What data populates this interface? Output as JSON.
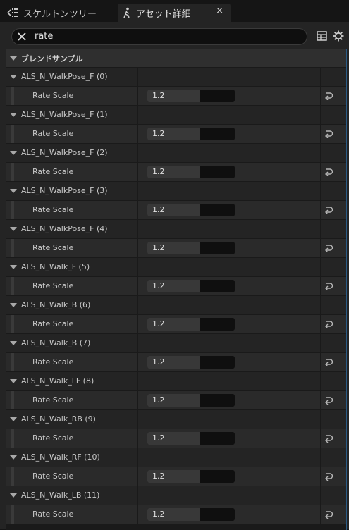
{
  "tabs": {
    "skeleton_tree": "スケルトンツリー",
    "asset_details": "アセット詳細",
    "close": "×"
  },
  "search": {
    "value": "rate",
    "placeholder": ""
  },
  "category": {
    "label": "ブレンドサンプル"
  },
  "samples": [
    {
      "name": "ALS_N_WalkPose_F (0)",
      "property": "Rate Scale",
      "value": "1.2",
      "fill": 0.6
    },
    {
      "name": "ALS_N_WalkPose_F (1)",
      "property": "Rate Scale",
      "value": "1.2",
      "fill": 0.6
    },
    {
      "name": "ALS_N_WalkPose_F (2)",
      "property": "Rate Scale",
      "value": "1.2",
      "fill": 0.6
    },
    {
      "name": "ALS_N_WalkPose_F (3)",
      "property": "Rate Scale",
      "value": "1.2",
      "fill": 0.6
    },
    {
      "name": "ALS_N_WalkPose_F (4)",
      "property": "Rate Scale",
      "value": "1.2",
      "fill": 0.6
    },
    {
      "name": "ALS_N_Walk_F (5)",
      "property": "Rate Scale",
      "value": "1.2",
      "fill": 0.6
    },
    {
      "name": "ALS_N_Walk_B (6)",
      "property": "Rate Scale",
      "value": "1.2",
      "fill": 0.6
    },
    {
      "name": "ALS_N_Walk_B (7)",
      "property": "Rate Scale",
      "value": "1.2",
      "fill": 0.6
    },
    {
      "name": "ALS_N_Walk_LF (8)",
      "property": "Rate Scale",
      "value": "1.2",
      "fill": 0.6
    },
    {
      "name": "ALS_N_Walk_RB (9)",
      "property": "Rate Scale",
      "value": "1.2",
      "fill": 0.6
    },
    {
      "name": "ALS_N_Walk_RF (10)",
      "property": "Rate Scale",
      "value": "1.2",
      "fill": 0.6
    },
    {
      "name": "ALS_N_Walk_LB (11)",
      "property": "Rate Scale",
      "value": "1.2",
      "fill": 0.6
    }
  ],
  "icons": {
    "skeleton_tab": "skeleton-tree-icon",
    "asset_tab": "asset-details-icon",
    "clear": "clear-search-icon",
    "table": "table-view-icon",
    "settings": "gear-icon",
    "reset": "reset-to-default-icon"
  },
  "colors": {
    "panel": "#242424",
    "accent_border": "#2a5b86"
  }
}
